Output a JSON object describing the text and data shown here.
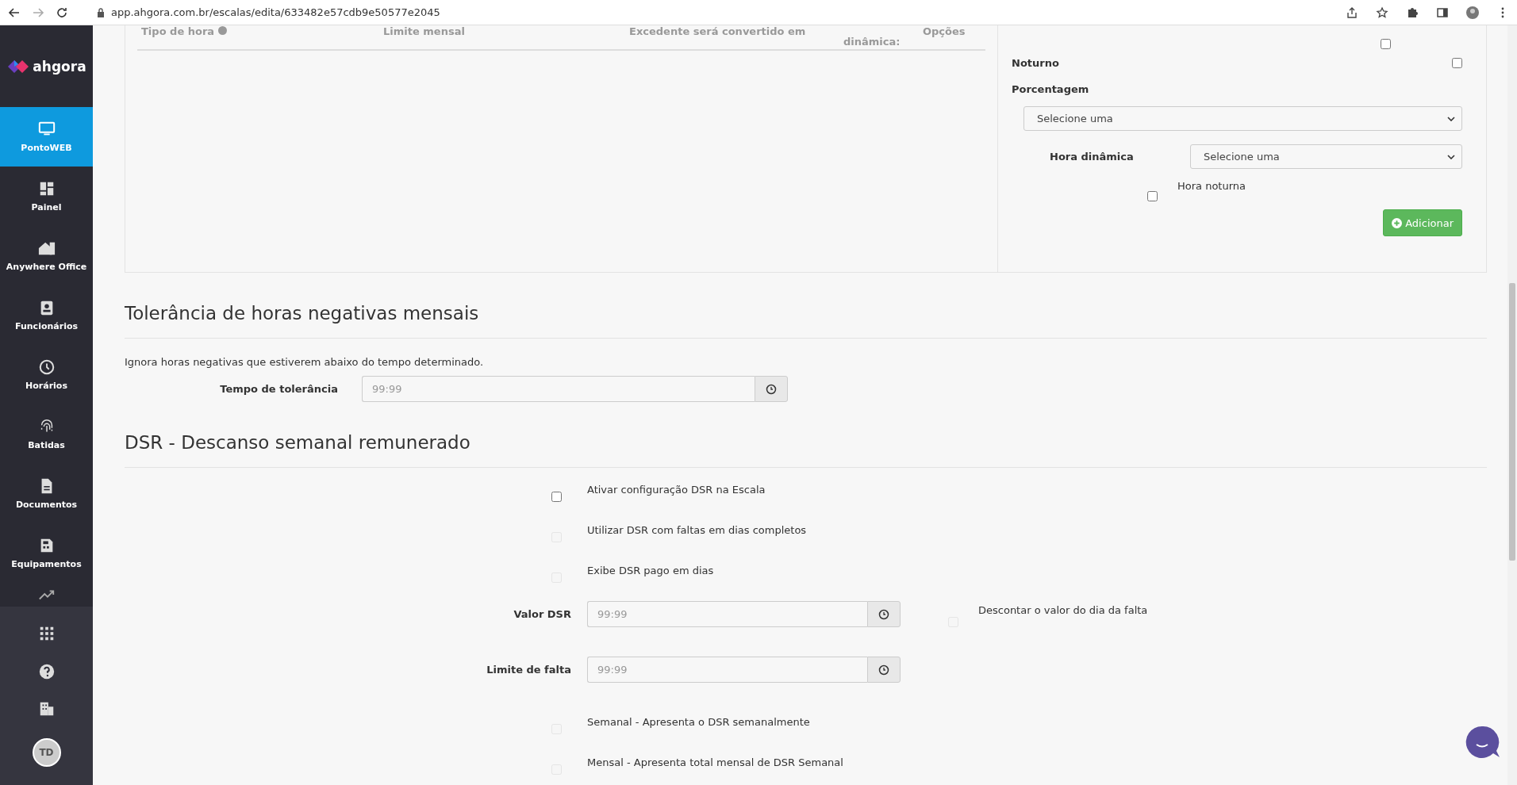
{
  "browser": {
    "url": "app.ahgora.com.br/escalas/edita/633482e57cdb9e50577e2045",
    "avatar": "TD"
  },
  "sidebar": {
    "logo": "ahgora",
    "items": [
      {
        "label": "PontoWEB",
        "selected": true
      },
      {
        "label": "Painel",
        "selected": false
      },
      {
        "label": "Anywhere Office",
        "selected": false
      },
      {
        "label": "Funcionários",
        "selected": false
      },
      {
        "label": "Horários",
        "selected": false
      },
      {
        "label": "Batidas",
        "selected": false
      },
      {
        "label": "Documentos",
        "selected": false
      },
      {
        "label": "Equipamentos",
        "selected": false
      },
      {
        "selected": false
      }
    ]
  },
  "hour_table": {
    "columns": [
      "Tipo de hora",
      "Limite mensal",
      "Excedente será convertido em",
      "dinâmica:",
      "Opções"
    ]
  },
  "hour_form": {
    "top_checks": [
      {
        "checked": false
      }
    ],
    "noturno": {
      "label": "Noturno",
      "checked": false
    },
    "porcentagem": {
      "label": "Porcentagem",
      "value": "Selecione uma"
    },
    "hora_dinamica": {
      "label": "Hora dinâmica",
      "value": "Selecione uma"
    },
    "hora_noturna": {
      "label": "Hora noturna",
      "checked": false
    },
    "add_button": "Adicionar"
  },
  "tolerance": {
    "title": "Tolerância de horas negativas mensais",
    "description": "Ignora horas negativas que estiverem abaixo do tempo determinado.",
    "field": {
      "label": "Tempo de tolerância",
      "placeholder": "99:99"
    }
  },
  "dsr": {
    "title": "DSR - Descanso semanal remunerado",
    "rows": [
      {
        "kind": "check",
        "label": "Ativar configuração DSR na Escala",
        "checked": false,
        "disabled": false
      },
      {
        "kind": "check",
        "label": "Utilizar DSR com faltas em dias completos",
        "checked": false,
        "disabled": true
      },
      {
        "kind": "check",
        "label": "Exibe DSR pago em dias",
        "checked": false,
        "disabled": true
      },
      {
        "kind": "time",
        "label": "Valor DSR",
        "placeholder": "99:99",
        "side_check": {
          "label": "Descontar o valor do dia da falta",
          "checked": false,
          "disabled": true
        }
      },
      {
        "kind": "time",
        "label": "Limite de falta",
        "placeholder": "99:99"
      },
      {
        "kind": "check",
        "label": "Semanal - Apresenta o DSR semanalmente",
        "checked": false,
        "disabled": true
      },
      {
        "kind": "check",
        "label": "Mensal - Apresenta total mensal de DSR Semanal",
        "checked": false,
        "disabled": true
      }
    ]
  }
}
